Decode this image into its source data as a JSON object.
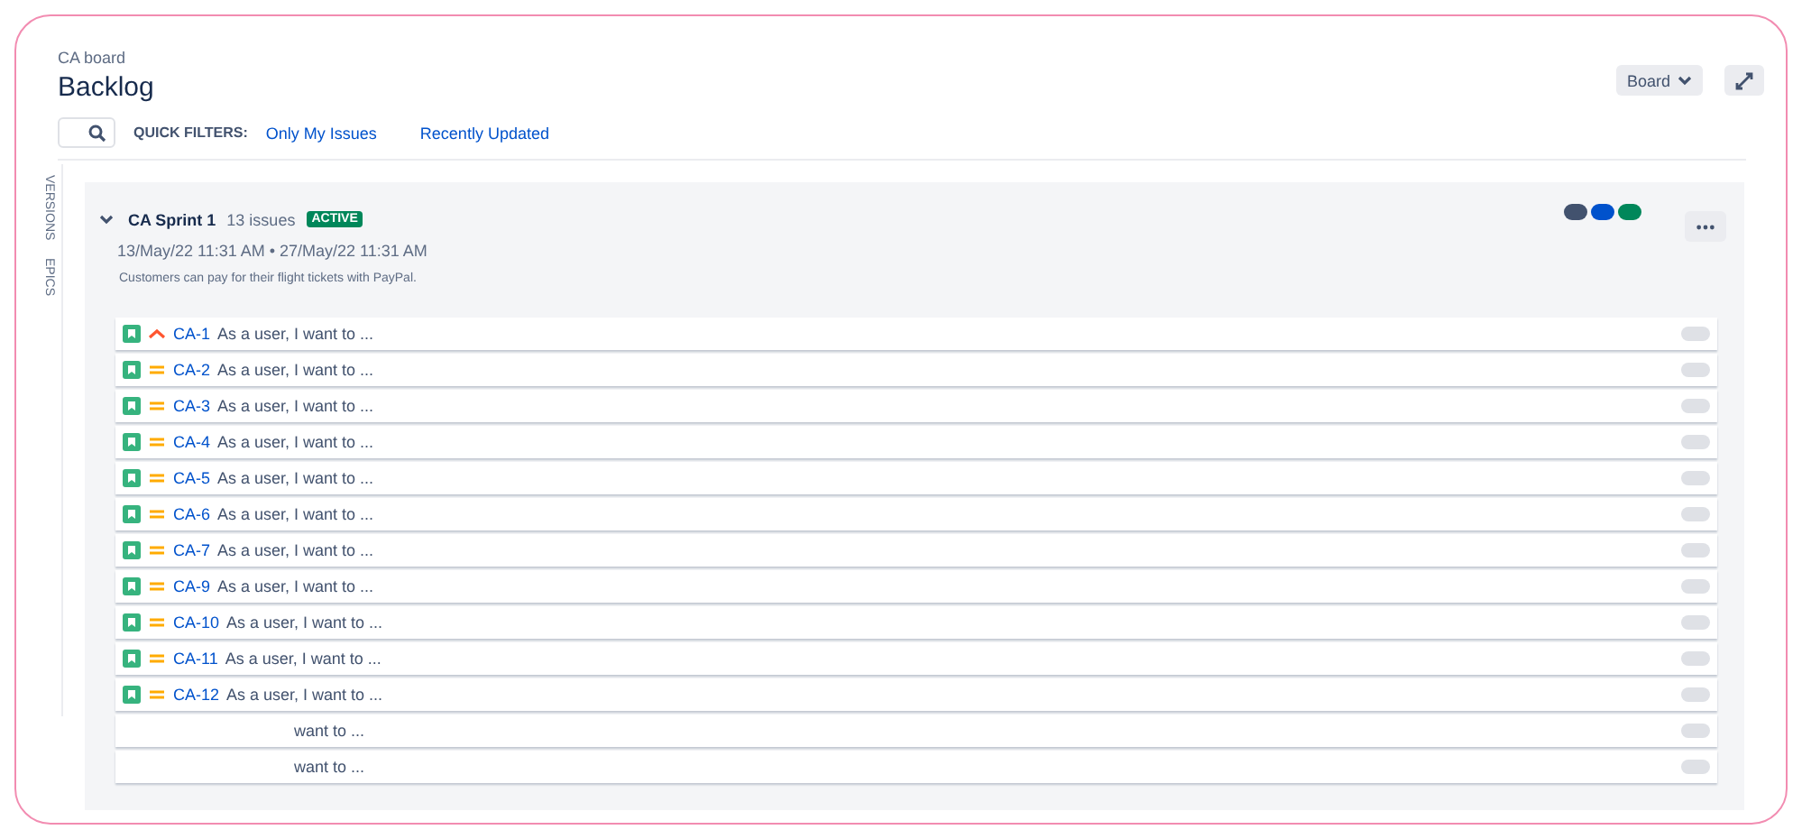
{
  "breadcrumb": "CA board",
  "title": "Backlog",
  "board_button": "Board",
  "quick_filters": {
    "label": "QUICK FILTERS:",
    "filters": [
      "Only My Issues",
      "Recently Updated"
    ]
  },
  "side_tabs": [
    "VERSIONS",
    "EPICS"
  ],
  "sprint": {
    "name": "CA Sprint 1",
    "count": "13 issues",
    "status": "ACTIVE",
    "expanded": true,
    "dates": "13/May/22 11:31 AM  •  27/May/22 11:31 AM",
    "goal": "Customers can pay for their flight tickets with PayPal.",
    "epics": [
      {
        "color": "#42526e"
      },
      {
        "color": "#0052cc"
      },
      {
        "color": "#00875a"
      }
    ],
    "issues": [
      {
        "key": "CA-1",
        "kind": "high",
        "summary": "As a user, I want to ..."
      },
      {
        "key": "CA-2",
        "kind": "medium",
        "summary": "As a user, I want to ..."
      },
      {
        "key": "CA-3",
        "kind": "medium",
        "summary": "As a user, I want to ..."
      },
      {
        "key": "CA-4",
        "kind": "medium",
        "summary": "As a user, I want to ..."
      },
      {
        "key": "CA-5",
        "kind": "medium",
        "summary": "As a user, I want to ..."
      },
      {
        "key": "CA-6",
        "kind": "medium",
        "summary": "As a user, I want to ..."
      },
      {
        "key": "CA-7",
        "kind": "medium",
        "summary": "As a user, I want to ..."
      },
      {
        "key": "CA-9",
        "kind": "medium",
        "summary": "As a user, I want to ..."
      },
      {
        "key": "CA-10",
        "kind": "medium",
        "summary": "As a user, I want to ..."
      },
      {
        "key": "CA-11",
        "kind": "medium",
        "summary": "As a user, I want to ..."
      },
      {
        "key": "CA-12",
        "kind": "medium",
        "summary": "As a user, I want to ..."
      },
      {
        "summary": "want to ..."
      },
      {
        "summary": "want to ..."
      }
    ]
  }
}
